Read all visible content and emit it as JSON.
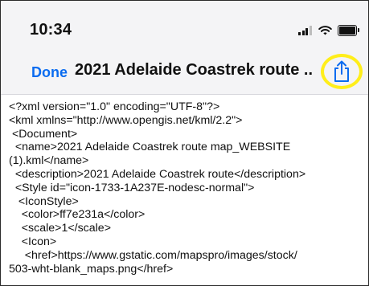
{
  "status_bar": {
    "time": "10:34",
    "icons": [
      "signal-icon",
      "wifi-icon",
      "battery-icon"
    ]
  },
  "nav": {
    "done_label": "Done",
    "title": "2021 Adelaide Coastrek route ..",
    "share_icon": "share-icon",
    "accent_color": "#0a6cf0",
    "highlight_color": "#ffee1a"
  },
  "document": {
    "lines": [
      "<?xml version=\"1.0\" encoding=\"UTF-8\"?>",
      "<kml xmlns=\"http://www.opengis.net/kml/2.2\">",
      " <Document>",
      "  <name>2021 Adelaide Coastrek route map_WEBSITE",
      "(1).kml</name>",
      "  <description>2021 Adelaide Coastrek route</description>",
      "  <Style id=\"icon-1733-1A237E-nodesc-normal\">",
      "   <IconStyle>",
      "    <color>ff7e231a</color>",
      "    <scale>1</scale>",
      "    <Icon>",
      "     <href>https://www.gstatic.com/mapspro/images/stock/",
      "503-wht-blank_maps.png</href>"
    ]
  }
}
